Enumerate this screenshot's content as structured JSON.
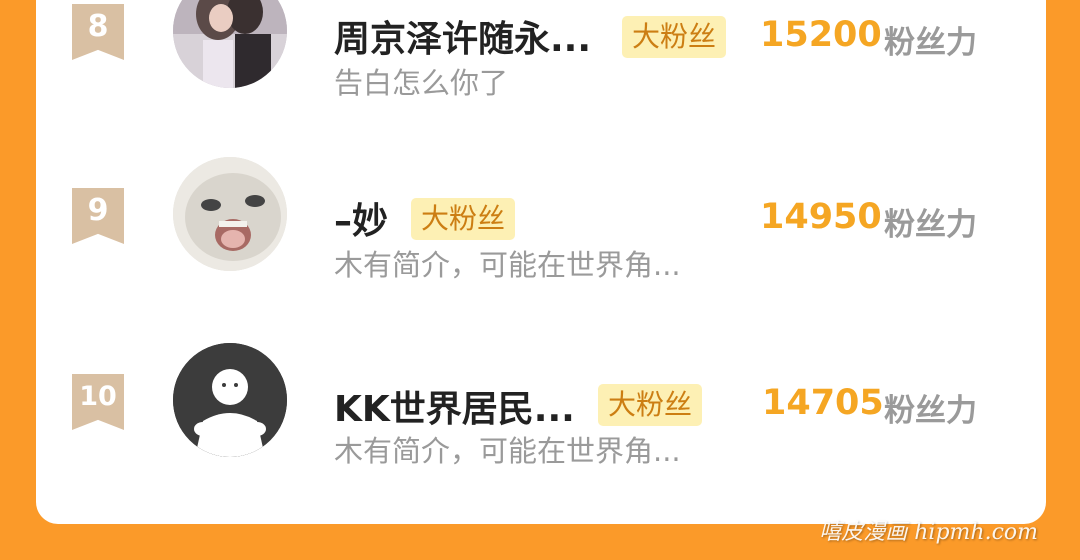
{
  "rows": [
    {
      "rank": "8",
      "name": "周京泽许随永...",
      "tag": "大粉丝",
      "bio": "告白怎么你了",
      "score": "15200",
      "unit": "粉丝力"
    },
    {
      "rank": "9",
      "name": "–妙",
      "tag": "大粉丝",
      "bio": "木有简介，可能在世界角...",
      "score": "14950",
      "unit": "粉丝力"
    },
    {
      "rank": "10",
      "name": "KK世界居民...",
      "tag": "大粉丝",
      "bio": "木有简介，可能在世界角...",
      "score": "14705",
      "unit": "粉丝力"
    }
  ],
  "watermark": "嘻皮漫画 hipmh.com",
  "colors": {
    "background": "#fb9a29",
    "card": "#ffffff",
    "rank_badge": "#d9c0a3",
    "tag_bg": "#fdf0b4",
    "score": "#f5a623"
  }
}
